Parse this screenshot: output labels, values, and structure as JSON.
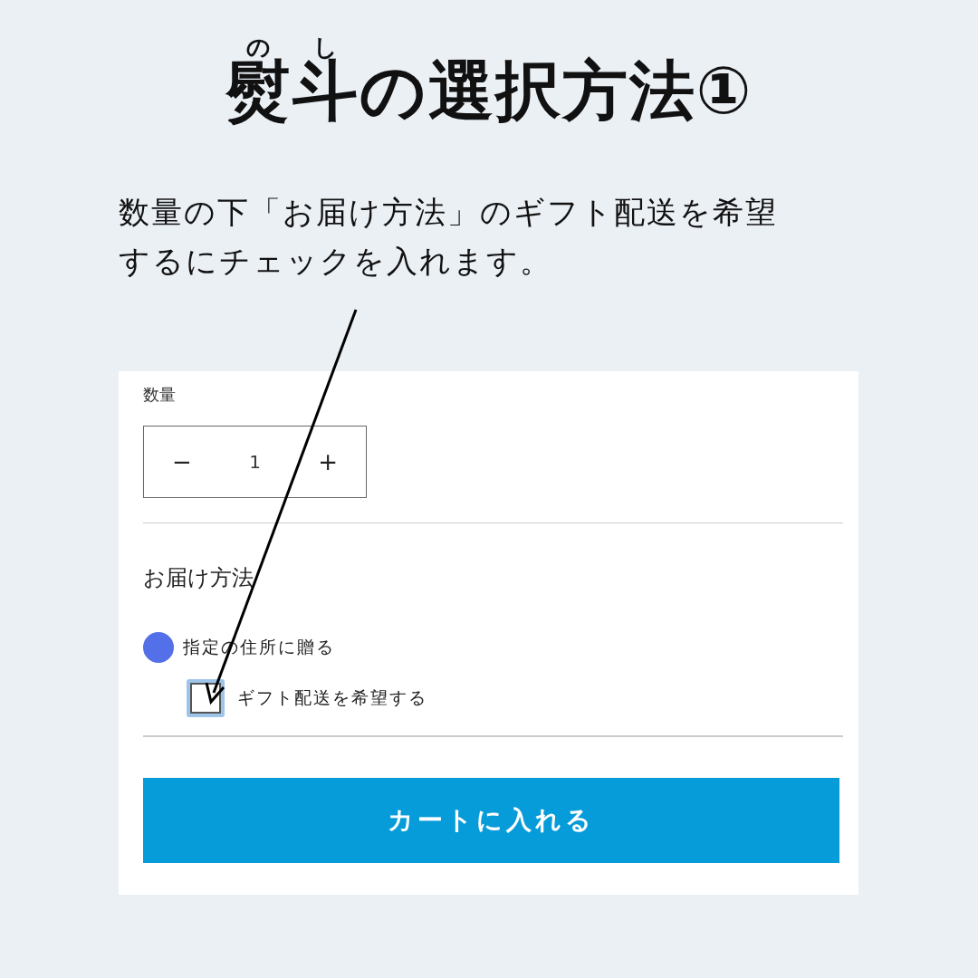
{
  "title": [
    {
      "text": "熨",
      "ruby": "の"
    },
    {
      "text": "斗",
      "ruby": "し"
    },
    {
      "text": "の選択方法①"
    }
  ],
  "instruction_lines": [
    "数量の下「お届け方法」のギフト配送を希望",
    "するにチェックを入れます。"
  ],
  "form": {
    "quantity_label": "数量",
    "quantity": {
      "minus": "−",
      "value": "1",
      "plus": "+"
    },
    "delivery_heading": "お届け方法",
    "options": [
      {
        "kind": "radio",
        "label": "指定の住所に贈る",
        "selected": true
      },
      {
        "kind": "checkbox",
        "label": "ギフト配送を希望する",
        "checked": false
      }
    ],
    "cart_button": "カートに入れる"
  }
}
